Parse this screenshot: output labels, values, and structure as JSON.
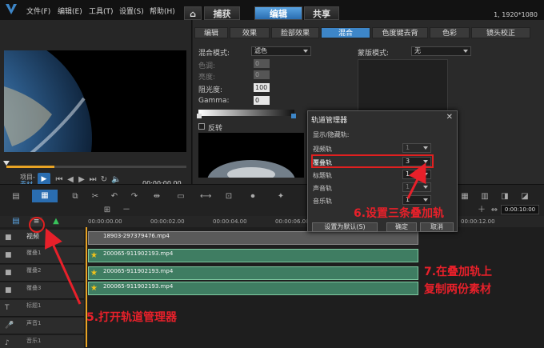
{
  "titlebar": {
    "menus": [
      "文件(F)",
      "编辑(E)",
      "工具(T)",
      "设置(S)",
      "帮助(H)"
    ],
    "tabs": [
      {
        "label": "捕获",
        "active": false
      },
      {
        "label": "编辑",
        "active": true
      },
      {
        "label": "共享",
        "active": false
      }
    ],
    "resolution": "1, 1920*1080"
  },
  "preview": {
    "project_label": "项目-",
    "clip_label": "素材-",
    "timecode": "00:00:00.00"
  },
  "options": {
    "subtabs": [
      {
        "label": "编辑",
        "active": false
      },
      {
        "label": "效果",
        "active": false
      },
      {
        "label": "脸部效果",
        "active": false
      },
      {
        "label": "混合",
        "active": true
      },
      {
        "label": "色度键去背",
        "active": false
      },
      {
        "label": "色彩",
        "active": false
      },
      {
        "label": "镜头校正",
        "active": false
      }
    ],
    "blend_mode_label": "混合模式:",
    "blend_mode_value": "滤色",
    "hue_label": "色调:",
    "saturation_label": "亮度:",
    "hue_value": "0",
    "saturation_value": "0",
    "opacity_label": "阻光度:",
    "opacity_value": "100",
    "gamma_label": "Gamma:",
    "gamma_value": "0",
    "invert_label": "反转",
    "mask_mode_label": "蒙版模式:",
    "mask_mode_value": "无"
  },
  "track_dialog": {
    "title": "轨道管理器",
    "show_hide_label": "显示/隐藏轨:",
    "rows": [
      {
        "label": "视频轨",
        "value": "1"
      },
      {
        "label": "覆叠轨",
        "value": "3"
      },
      {
        "label": "标题轨",
        "value": "1"
      },
      {
        "label": "声音轨",
        "value": "1"
      },
      {
        "label": "音乐轨",
        "value": "1"
      }
    ],
    "set_default_label": "设置为默认(S)",
    "ok_label": "确定",
    "cancel_label": "取消"
  },
  "timeline": {
    "timecode_right": "0:00:10:00",
    "ruler": [
      "00:00:00.00",
      "00:00:02.00",
      "00:00:04.00",
      "00:00:06.00",
      "00:00:12.00"
    ],
    "video_track_label": "视频",
    "tracks": [
      {
        "label": "覆叠1",
        "clip": "18903-297379476.mp4"
      },
      {
        "label": "覆叠2",
        "clip": "200065-911902193.mp4"
      },
      {
        "label": "覆叠3",
        "clip": "200065-911902193.mp4"
      },
      {
        "label": "标题1",
        "clip": "200065-911902193.mp4"
      }
    ],
    "extra_tracks": [
      "声音1",
      "音乐1"
    ]
  },
  "annotations": {
    "step5": "5.打开轨道管理器",
    "step6": "6.设置三条叠加轨",
    "step7_line1": "7.在叠加轨上",
    "step7_line2": "复制两份素材"
  },
  "colors": {
    "accent": "#3d86c8",
    "annotation": "#e8202a",
    "clip_green": "#3f7d62"
  }
}
